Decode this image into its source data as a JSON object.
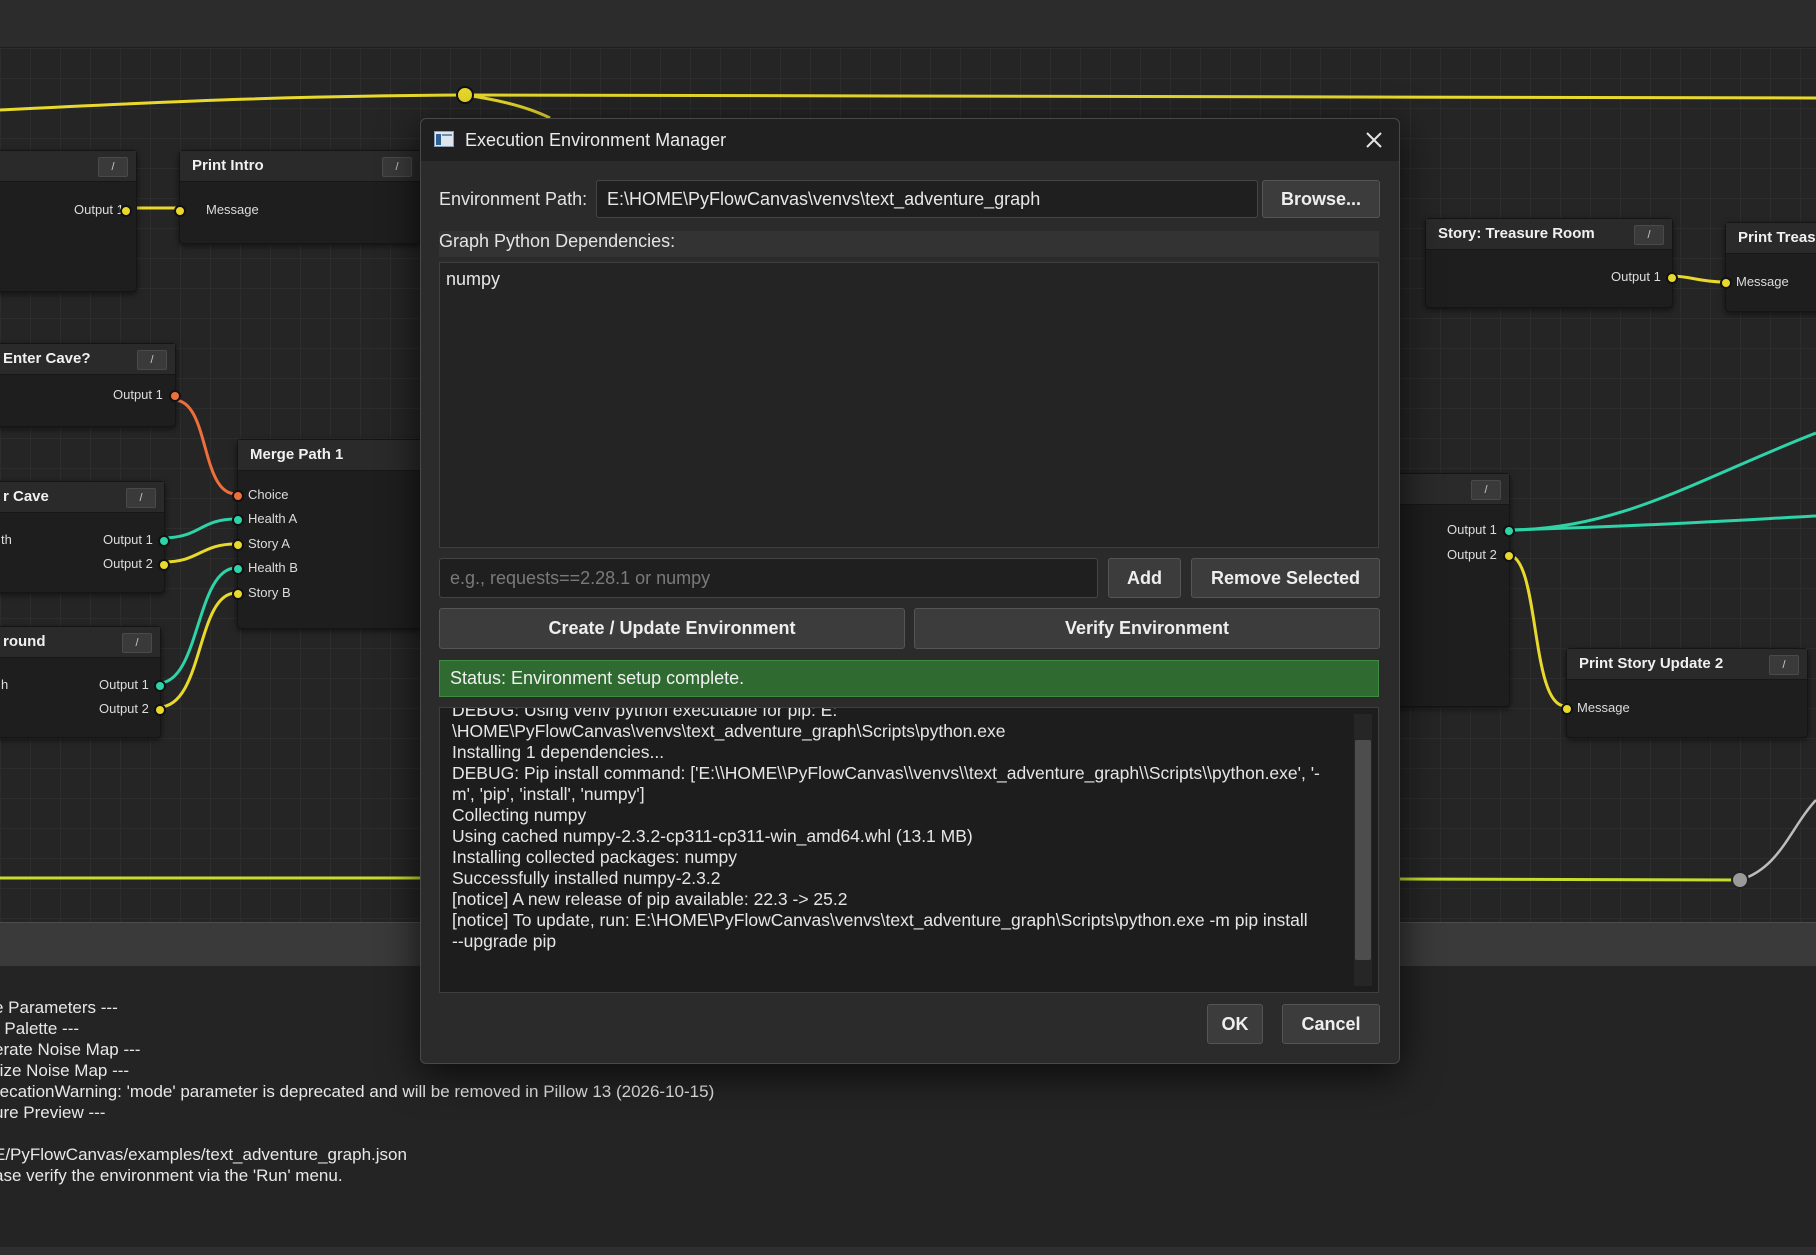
{
  "canvas": {
    "nodes": {
      "top_left_node": {
        "port_out": "Output 1"
      },
      "print_intro": {
        "title": "Print Intro",
        "port_in": "Message"
      },
      "enter_cave": {
        "title": "Enter Cave?",
        "port_out": "Output 1"
      },
      "merge_path": {
        "title": "Merge Path 1",
        "ports_in": [
          "Choice",
          "Health A",
          "Story A",
          "Health B",
          "Story B"
        ]
      },
      "cave_node": {
        "title": "r Cave",
        "left_text": "th",
        "port_out1": "Output 1",
        "port_out2": "Output 2"
      },
      "around_node": {
        "title": "round",
        "left_text": "h",
        "port_out1": "Output 1",
        "port_out2": "Output 2"
      },
      "treasure_room": {
        "title": "Story: Treasure Room",
        "port_out": "Output 1"
      },
      "print_treasure": {
        "title": "Print Treas",
        "port_in": "Message"
      },
      "right_mid_node": {
        "port_out1": "Output 1",
        "port_out2": "Output 2"
      },
      "print_story_update2": {
        "title": "Print Story Update 2",
        "port_in": "Message"
      }
    },
    "toggle_label": "/",
    "colors": {
      "yellow": "#e8d92c",
      "teal": "#2ed3a8",
      "orange": "#ee6e3c",
      "gray": "#9a9a9a"
    }
  },
  "console_log": [
    "e Parameters ---",
    "r Palette ---",
    "erate Noise Map ---",
    "rize Noise Map ---",
    "recationWarning: 'mode' parameter is deprecated and will be removed in Pillow 13 (2026-10-15)",
    "ure Preview ---",
    "",
    "E/PyFlowCanvas/examples/text_adventure_graph.json",
    "ase verify the environment via the 'Run' menu."
  ],
  "dialog": {
    "title": "Execution Environment Manager",
    "env_path_label": "Environment Path:",
    "env_path_value": "E:\\HOME\\PyFlowCanvas\\venvs\\text_adventure_graph",
    "browse_label": "Browse...",
    "deps_label": "Graph Python Dependencies:",
    "deps": [
      "numpy"
    ],
    "dep_input_placeholder": "e.g., requests==2.28.1 or numpy",
    "add_label": "Add",
    "remove_label": "Remove Selected",
    "create_label": "Create / Update Environment",
    "verify_label": "Verify Environment",
    "status": "Status: Environment setup complete.",
    "log_lines": [
      "DEBUG: Using venv python executable for pip: E:",
      "\\HOME\\PyFlowCanvas\\venvs\\text_adventure_graph\\Scripts\\python.exe",
      "Installing 1 dependencies...",
      "DEBUG: Pip install command: ['E:\\\\HOME\\\\PyFlowCanvas\\\\venvs\\\\text_adventure_graph\\\\Scripts\\\\python.exe', '-",
      "m', 'pip', 'install', 'numpy']",
      "Collecting numpy",
      "Using cached numpy-2.3.2-cp311-cp311-win_amd64.whl (13.1 MB)",
      "Installing collected packages: numpy",
      "Successfully installed numpy-2.3.2",
      "",
      "[notice] A new release of pip available: 22.3 -> 25.2",
      "[notice] To update, run: E:\\HOME\\PyFlowCanvas\\venvs\\text_adventure_graph\\Scripts\\python.exe -m pip install",
      "--upgrade pip"
    ],
    "ok_label": "OK",
    "cancel_label": "Cancel"
  }
}
